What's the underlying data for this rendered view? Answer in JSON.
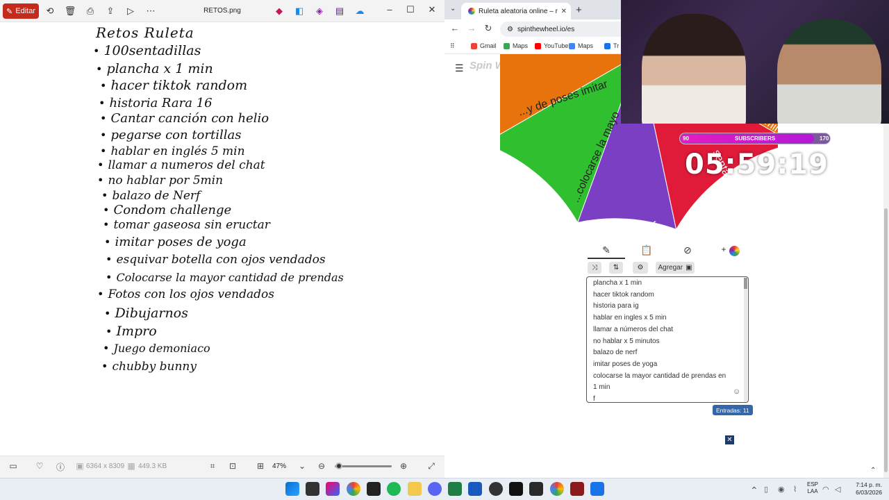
{
  "photos": {
    "edit_label": "Editar",
    "file_title": "RETOS.png",
    "dimensions": "6364 x 8309",
    "file_size": "449.3 KB",
    "zoom": "47%",
    "note": {
      "title": "Retos Ruleta",
      "items": [
        "100sentadillas",
        "plancha x 1 min",
        "hacer tiktok random",
        "historia Rara 16",
        "Cantar canción con helio",
        "pegarse con tortillas",
        "hablar en inglés 5 min",
        "llamar a numeros del chat",
        "no hablar por 5min",
        "balazo de Nerf",
        "Condom challenge",
        "tomar gaseosa sin eructar",
        "imitar poses de yoga",
        "esquivar botella con ojos vendados",
        "Colocarse la mayor cantidad de prendas",
        "Fotos con los ojos vendados",
        "Dibujarnos",
        "Impro",
        "Juego demoniaco",
        "chubby bunny"
      ]
    }
  },
  "browser": {
    "tab_title": "Ruleta aleatoria online – ruleta",
    "url": "spinthewheel.io/es",
    "bookmarks": [
      {
        "label": "Gmail",
        "color": "#ea4335"
      },
      {
        "label": "Maps",
        "color": "#34a853"
      },
      {
        "label": "YouTube",
        "color": "#ff0000"
      },
      {
        "label": "Maps",
        "color": "#4285f4"
      },
      {
        "label": "Tr",
        "color": "#1a73e8"
      }
    ],
    "logo": "Spin Wheel",
    "wheel_labels": {
      "orange": "...y de poses imitar",
      "green": "...colocarse la mayo",
      "red": "sentadillas",
      "purple": "f",
      "top_right": "x 1 min"
    },
    "wheel_colors": [
      "#e8720c",
      "#2fbf2f",
      "#7b3fc4",
      "#e01b3a",
      "#cc1a2b"
    ],
    "add_label": "Agregar",
    "entries": [
      "plancha x 1 min",
      "hacer tiktok random",
      "historia para ig",
      "hablar en ingles x 5 min",
      "llamar a números del chat",
      "no hablar x 5 minutos",
      "balazo de nerf",
      "imitar poses de yoga",
      "colocarse la mayor cantidad de prendas en",
      "1 min",
      "f"
    ],
    "entries_count": "Entradas: 11"
  },
  "stream": {
    "sub_left": "90",
    "sub_label": "SUBSCRIBERS",
    "sub_right": "170",
    "timer": "05:59:19"
  },
  "taskbar": {
    "lang_line1": "ESP",
    "lang_line2": "LAA",
    "time": "7:14 p. m.",
    "date": "6/03/2026"
  }
}
